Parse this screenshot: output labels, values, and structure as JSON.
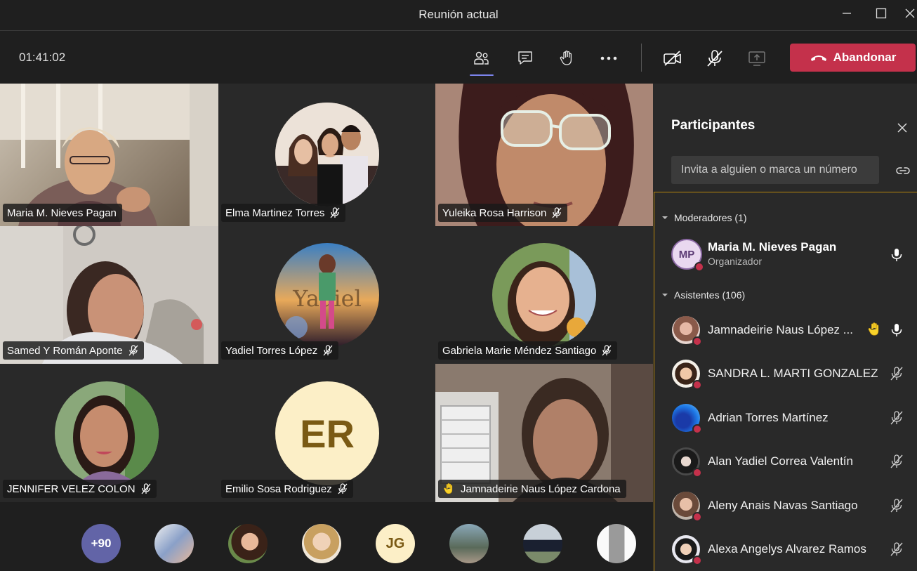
{
  "window": {
    "title": "Reunión actual"
  },
  "toolbar": {
    "timer": "01:41:02",
    "leave_label": "Abandonar",
    "icons": [
      "participants-icon",
      "chat-icon",
      "raise-hand-icon",
      "more-options-icon",
      "camera-off-icon",
      "mic-off-icon",
      "share-screen-icon"
    ]
  },
  "tiles": [
    {
      "name": "Maria M. Nieves Pagan",
      "muted": false
    },
    {
      "name": "Elma Martinez Torres",
      "muted": true
    },
    {
      "name": "Yuleika Rosa Harrison",
      "muted": true
    },
    {
      "name": "Samed Y Román Aponte",
      "muted": true
    },
    {
      "name": "Yadiel Torres López",
      "muted": true
    },
    {
      "name": "Gabriela Marie Méndez Santiago",
      "muted": true
    },
    {
      "name": "JENNIFER VELEZ COLON",
      "muted": true
    },
    {
      "name": "Emilio Sosa Rodriguez",
      "muted": true,
      "initials": "ER"
    },
    {
      "name": "Jamnadeirie Naus López Cardona",
      "hand_raised": true
    }
  ],
  "strip": {
    "overflow_count": "+90",
    "initials_avatar": "JG"
  },
  "panel": {
    "title": "Participantes",
    "invite_placeholder": "Invita a alguien o marca un número",
    "moderators_header": "Moderadores (1)",
    "attendees_header": "Asistentes (106)",
    "organizer": {
      "initials": "MP",
      "name": "Maria M. Nieves Pagan",
      "role": "Organizador"
    },
    "attendees": [
      {
        "name": "Jamnadeirie Naus López ...",
        "hand_raised": true,
        "muted": false
      },
      {
        "name": "SANDRA L. MARTI GONZALEZ",
        "muted": true
      },
      {
        "name": "Adrian Torres Martínez",
        "muted": true
      },
      {
        "name": "Alan Yadiel Correa Valentín",
        "muted": true
      },
      {
        "name": "Aleny Anais Navas Santiago",
        "muted": true
      },
      {
        "name": "Alexa Angelys Alvarez Ramos",
        "muted": true
      }
    ]
  },
  "colors": {
    "accent": "#7b83eb",
    "leave": "#c4314b",
    "panel_bg": "#292929",
    "app_bg": "#1f1f1f",
    "hand": "#f8d22a"
  }
}
